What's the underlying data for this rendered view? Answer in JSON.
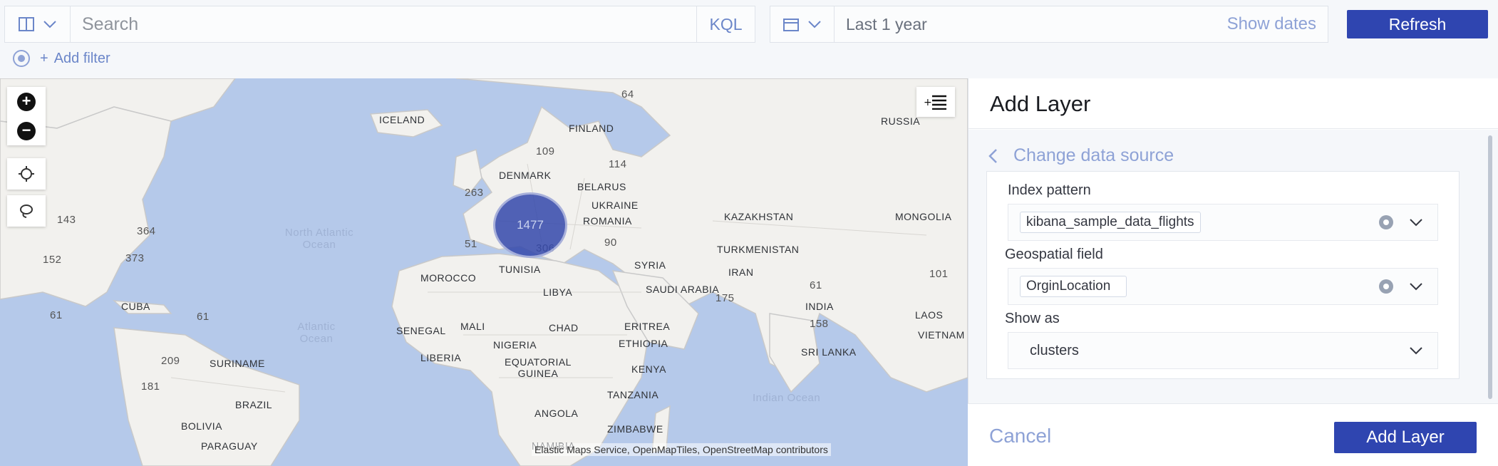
{
  "query_bar": {
    "search_placeholder": "Search",
    "kql_label": "KQL",
    "date_range": "Last 1 year",
    "show_dates_label": "Show dates",
    "refresh_label": "Refresh",
    "add_filter_label": "Add filter"
  },
  "map": {
    "cluster_count": "1477",
    "attribution": "Elastic Maps Service, OpenMapTiles, OpenStreetMap contributors",
    "labels": {
      "iceland": "ICELAND",
      "finland": "FINLAND",
      "russia": "RUSSIA",
      "denmark": "DENMARK",
      "belarus": "BELARUS",
      "ukraine": "UKRAINE",
      "romania": "ROMANIA",
      "kazakhstan": "KAZAKHSTAN",
      "mongolia": "MONGOLIA",
      "turkmenistan": "TURKMENISTAN",
      "syria": "SYRIA",
      "morocco": "MOROCCO",
      "tunisia": "TUNISIA",
      "libya": "LIBYA",
      "saudi_arabia": "SAUDI ARABIA",
      "iran": "IRAN",
      "india": "INDIA",
      "laos": "LAOS",
      "vietnam": "VIETNAM",
      "sri_lanka": "SRI LANKA",
      "cuba": "CUBA",
      "senegal": "SENEGAL",
      "mali": "MALI",
      "chad": "CHAD",
      "eritrea": "ERITREA",
      "nigeria": "NIGERIA",
      "ethiopia": "ETHIOPIA",
      "liberia": "LIBERIA",
      "equatorial_guinea": "EQUATORIAL GUINEA",
      "kenya": "KENYA",
      "tanzania": "TANZANIA",
      "angola": "ANGOLA",
      "zimbabwe": "ZIMBABWE",
      "suriname": "SURINAME",
      "brazil": "BRAZIL",
      "bolivia": "BOLIVIA",
      "paraguay": "PARAGUAY",
      "namibia": "NAMIBIA",
      "north_atlantic_ocean": "North Atlantic Ocean",
      "atlantic_ocean": "Atlantic Ocean",
      "indian_ocean": "Indian Ocean"
    },
    "counts": {
      "c64": "64",
      "c109": "109",
      "c114": "114",
      "c263": "263",
      "c143": "143",
      "c364": "364",
      "c152": "152",
      "c373": "373",
      "c51": "51",
      "c306": "306",
      "c90": "90",
      "c61a": "61",
      "c61b": "61",
      "c61c": "61",
      "c101": "101",
      "c175": "175",
      "c158": "158",
      "c209": "209",
      "c181": "181"
    }
  },
  "panel": {
    "title": "Add Layer",
    "change_source_label": "Change data source",
    "index_pattern_label": "Index pattern",
    "index_pattern_value": "kibana_sample_data_flights",
    "geo_field_label": "Geospatial field",
    "geo_field_value": "OrginLocation",
    "show_as_label": "Show as",
    "show_as_value": "clusters",
    "cancel_label": "Cancel",
    "add_layer_label": "Add Layer"
  },
  "colors": {
    "primary": "#2f45b0",
    "link": "#8ea2d6",
    "water": "#b5c9ea",
    "land": "#f2f1ee"
  }
}
